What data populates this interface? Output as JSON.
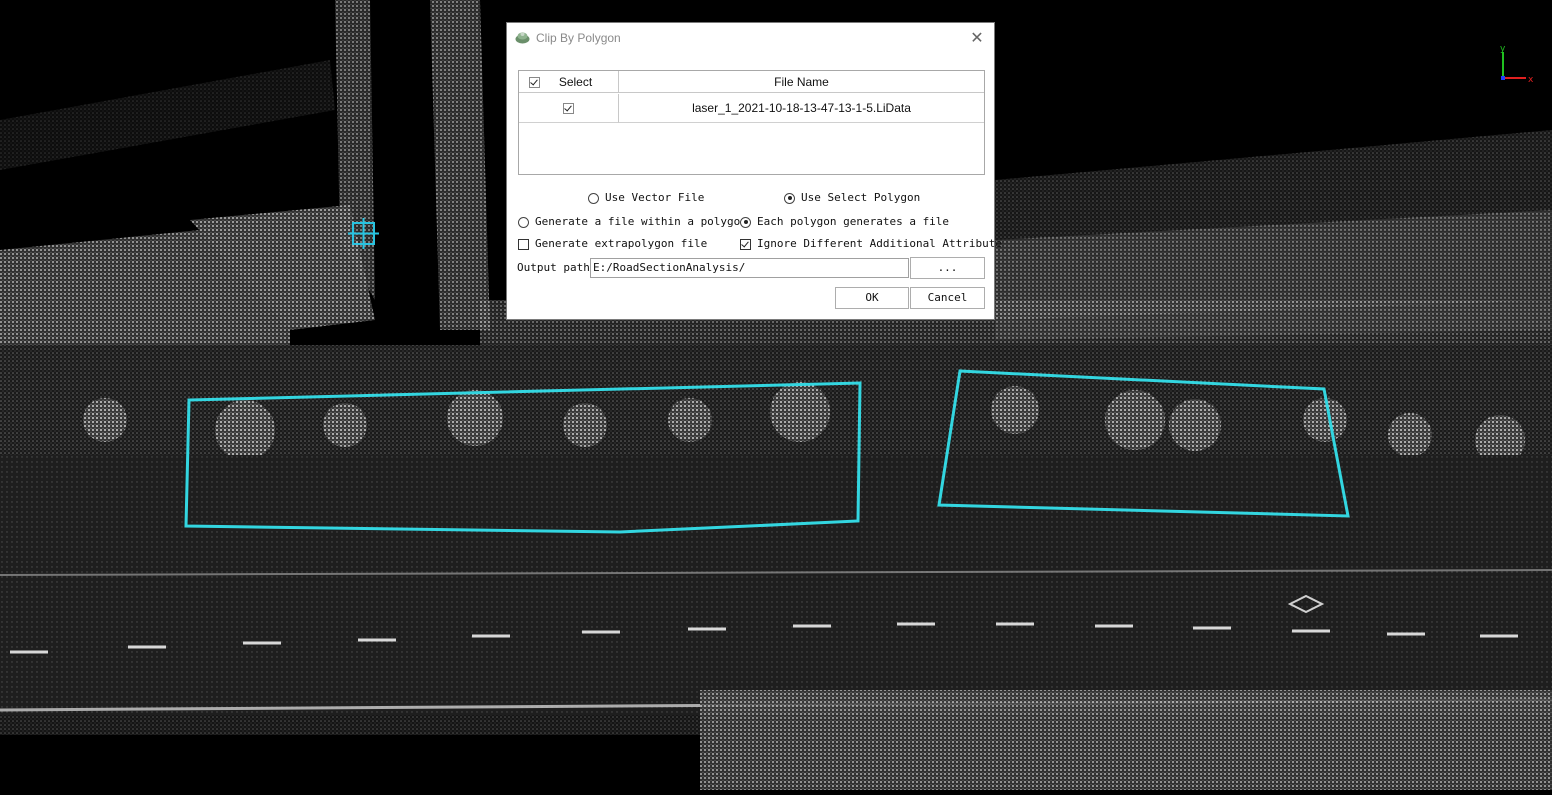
{
  "dialog": {
    "title": "Clip By Polygon",
    "close_icon": "close-icon",
    "table": {
      "headers": {
        "select": "Select",
        "file_name": "File Name"
      },
      "header_checked": true,
      "rows": [
        {
          "checked": true,
          "file_name": "laser_1_2021-10-18-13-47-13-1-5.LiData"
        }
      ]
    },
    "options": {
      "use_vector_file": {
        "label": "Use Vector File",
        "checked": false
      },
      "use_select_polygon": {
        "label": "Use Select Polygon",
        "checked": true
      },
      "generate_within_polygon": {
        "label": "Generate a file within a polygon",
        "checked": false
      },
      "each_polygon_generates": {
        "label": "Each polygon generates a file",
        "checked": true
      },
      "generate_extrapolygon": {
        "label": "Generate extrapolygon file",
        "checked": false
      },
      "ignore_additional_attribute": {
        "label": "Ignore Different Additional Attribute",
        "checked": true
      }
    },
    "output_path": {
      "label": "Output path:",
      "value": "E:/RoadSectionAnalysis/"
    },
    "browse_label": "...",
    "ok_label": "OK",
    "cancel_label": "Cancel"
  },
  "axis_gizmo": {
    "x_label": "x",
    "y_label": "y",
    "x_color": "#e02020",
    "y_color": "#20c020",
    "z_color": "#2040ff"
  },
  "colors": {
    "polygon": "#33d6e0",
    "cursor": "#29c3e0"
  }
}
